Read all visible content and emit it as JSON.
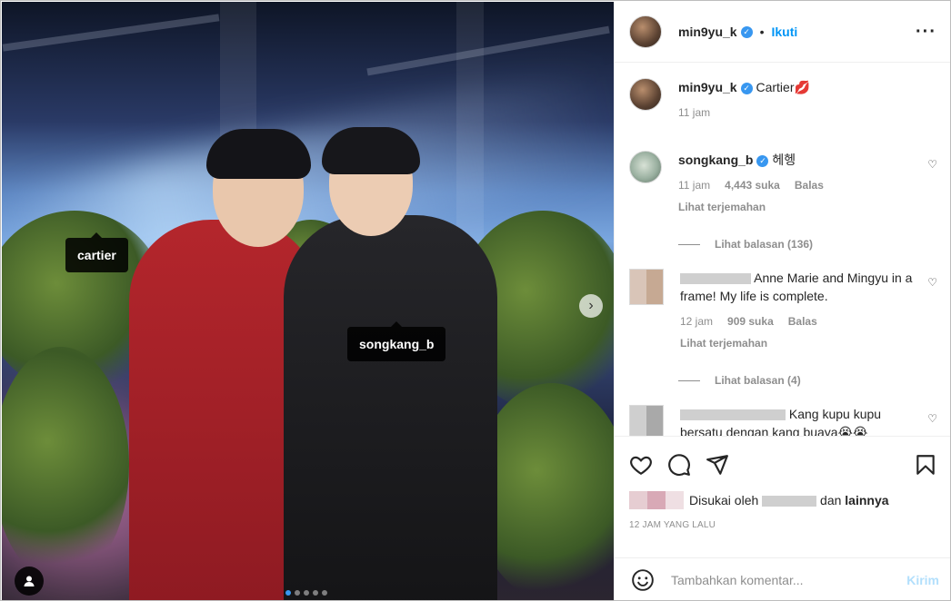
{
  "photo": {
    "tags": {
      "cartier": "cartier",
      "songkang": "songkang_b"
    },
    "next_icon": "chevron-right-icon",
    "carousel_dots": 5,
    "carousel_active": 0
  },
  "header": {
    "username": "min9yu_k",
    "verified": true,
    "follow_label": "Ikuti",
    "bullet": "•"
  },
  "caption": {
    "username": "min9yu_k",
    "text": "Cartier💋",
    "time": "11 jam"
  },
  "comments": [
    {
      "username": "songkang_b",
      "text": "헤헹",
      "time": "11 jam",
      "likes": "4,443 suka",
      "reply_label": "Balas",
      "translate_label": "Lihat terjemahan",
      "replies_label": "Lihat balasan (136)"
    },
    {
      "username": "",
      "text": "Anne Marie and Mingyu in a frame! My life is complete.",
      "time": "12 jam",
      "likes": "909 suka",
      "reply_label": "Balas",
      "translate_label": "Lihat terjemahan",
      "replies_label": "Lihat balasan (4)"
    },
    {
      "username": "",
      "text": "Kang kupu kupu bersatu dengan kang buaya😭😭"
    }
  ],
  "actions": {
    "liked_by_prefix": "Disukai oleh",
    "liked_by_and": "dan",
    "liked_by_others": "lainnya",
    "timestamp": "12 JAM YANG LALU"
  },
  "add_comment": {
    "placeholder": "Tambahkan komentar...",
    "send_label": "Kirim"
  },
  "colors": {
    "accent": "#0095f6",
    "verified": "#3897f0"
  }
}
